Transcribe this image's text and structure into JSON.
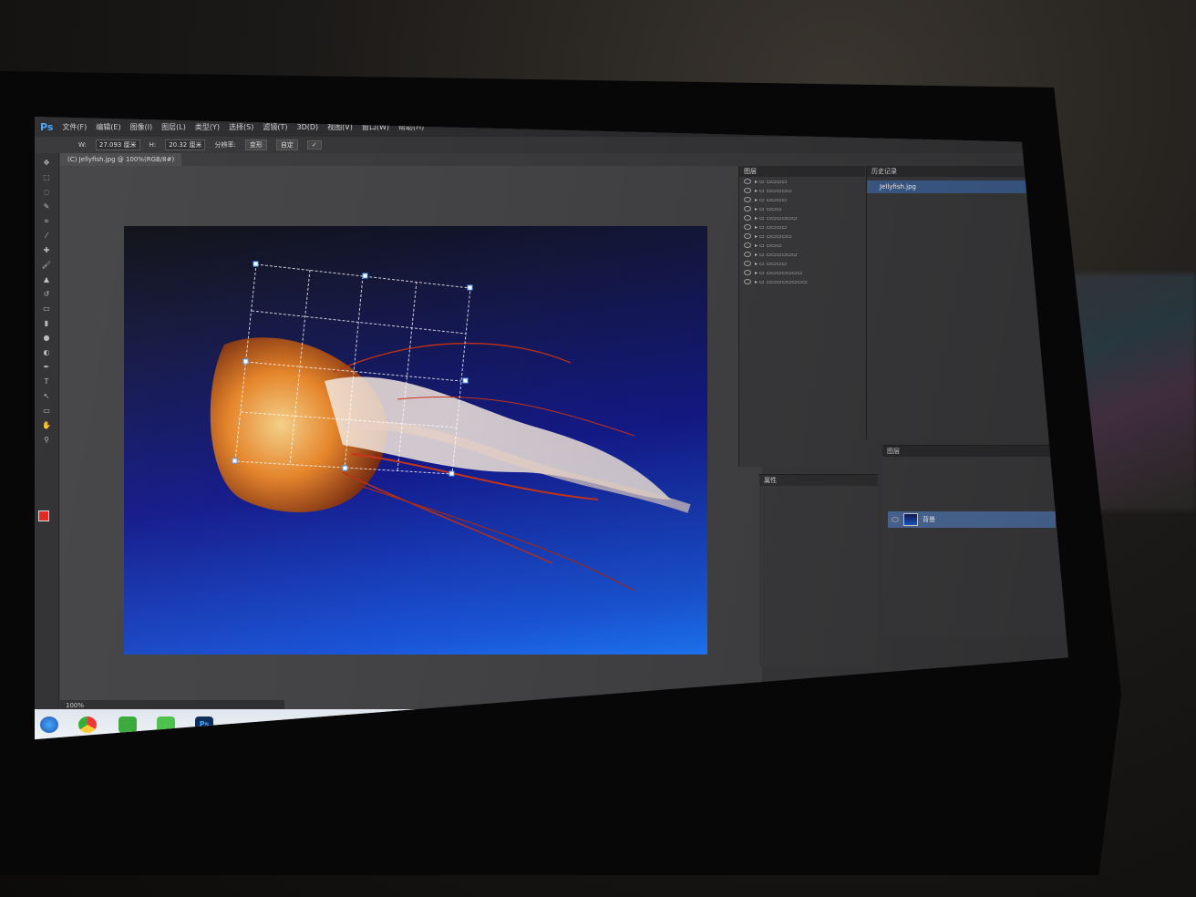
{
  "menubar": {
    "logo": "Ps",
    "items": [
      "文件(F)",
      "编辑(E)",
      "图像(I)",
      "图层(L)",
      "类型(Y)",
      "选择(S)",
      "滤镜(T)",
      "3D(D)",
      "视图(V)",
      "窗口(W)",
      "帮助(H)"
    ]
  },
  "options": {
    "w_label": "W:",
    "w_value": "27.093 厘米",
    "h_label": "H:",
    "h_value": "20.32 厘米",
    "resolution_label": "分辨率:",
    "mode": "变形",
    "transform": "自定",
    "commit": "✓"
  },
  "document": {
    "tab": "(C) Jellyfish.jpg @ 100%(RGB/8#)",
    "zoom": "100%"
  },
  "panels": {
    "history_title": "历史记录",
    "history_item": "Jellyfish.jpg",
    "comps_title": "图层",
    "props_title": "属性",
    "layers_title": "图层",
    "layer_name": "背景"
  },
  "taskbar": {
    "ps": "Ps"
  },
  "colors": {
    "photo_top": "#14173a",
    "photo_bottom": "#1e7aff",
    "selection": "#3e5f8f",
    "foreground_swatch": "#e0241c"
  }
}
